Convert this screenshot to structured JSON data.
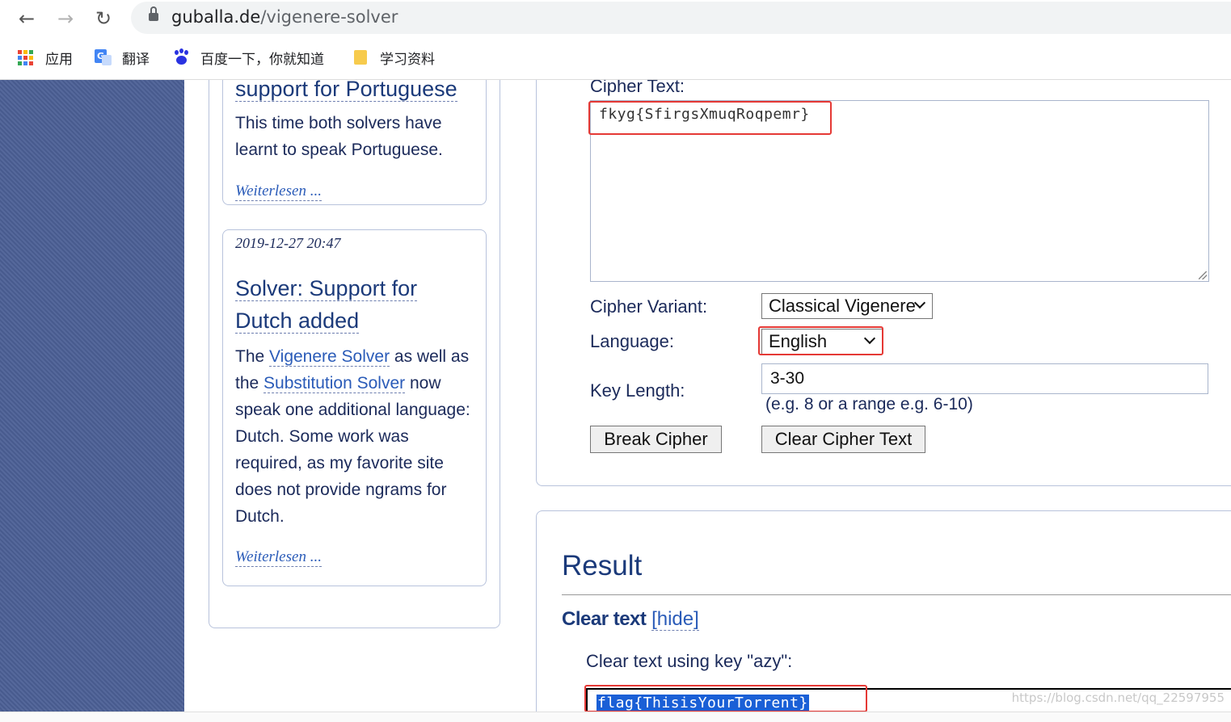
{
  "browser": {
    "url_host": "guballa.de",
    "url_path": "/vigenere-solver",
    "bookmarks": [
      {
        "label": "应用",
        "icon": "apps-grid-icon"
      },
      {
        "label": "翻译",
        "icon": "translate-icon"
      },
      {
        "label": "百度一下，你就知道",
        "icon": "baidu-paw-icon"
      },
      {
        "label": "学习资料",
        "icon": "folder-icon"
      }
    ]
  },
  "news": {
    "card1": {
      "title": "support for Portuguese",
      "text": "This time both solvers have learnt to speak Portuguese.",
      "readmore": "Weiterlesen ..."
    },
    "card2": {
      "date": "2019-12-27 20:47",
      "title_line1": "Solver: Support for",
      "title_line2": "Dutch added",
      "text_pre": "The ",
      "link1": "Vigenere Solver",
      "text_mid": " as well as the ",
      "link2": "Substitution Solver",
      "text_post": " now speak one additional language: Dutch. Some work was required, as my favorite site does not provide ngrams for Dutch.",
      "readmore": "Weiterlesen ..."
    }
  },
  "form": {
    "ciphertext_label": "Cipher Text:",
    "ciphertext_value": "fkyg{SfirgsXmuqRoqpemr}",
    "variant_label": "Cipher Variant:",
    "variant_value": "Classical Vigenere",
    "language_label": "Language:",
    "language_value": "English",
    "keylength_label": "Key Length:",
    "keylength_value": "3-30",
    "keylength_hint": "(e.g. 8 or a range e.g. 6-10)",
    "break_button": "Break Cipher",
    "clear_button": "Clear Cipher Text"
  },
  "result": {
    "title": "Result",
    "cleartext_heading": "Clear text",
    "hide_link": "[hide]",
    "key_line": "Clear text using key \"azy\":",
    "output_value": "flag{ThisisYourTorrent}"
  },
  "watermark": "https://blog.csdn.net/qq_22597955",
  "colors": {
    "sidebar": "#4c6096",
    "highlight_box": "#e53935",
    "selection": "#1a5fd6",
    "link": "#2a5bb8"
  }
}
